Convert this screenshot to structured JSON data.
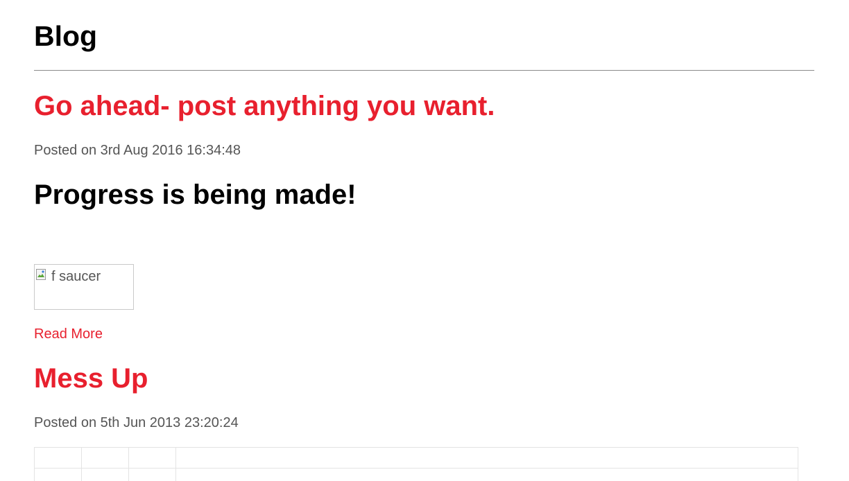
{
  "blog": {
    "title": "Blog"
  },
  "posts": [
    {
      "title": "Go ahead- post anything you want.",
      "meta": "Posted on 3rd Aug 2016 16:34:48",
      "heading": "Progress is being made!",
      "image_alt": "f saucer",
      "read_more": "Read More"
    },
    {
      "title": "Mess Up",
      "meta": "Posted on 5th Jun 2013 23:20:24"
    }
  ],
  "colors": {
    "accent": "#e8202e",
    "meta_text": "#555555",
    "divider": "#8a8a8a"
  },
  "icons": {
    "broken_image": "broken-image-icon"
  }
}
